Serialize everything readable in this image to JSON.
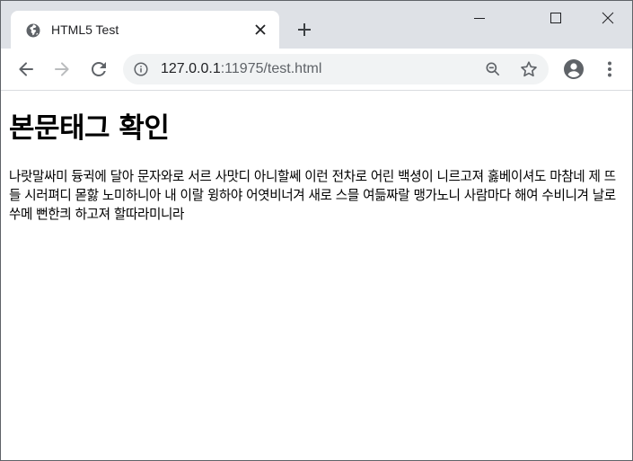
{
  "browser": {
    "tab": {
      "title": "HTML5 Test"
    },
    "address_bar": {
      "host": "127.0.0.1",
      "port_path": ":11975/test.html"
    }
  },
  "page": {
    "heading": "본문태그 확인",
    "paragraph": "나랏말싸미 듕귁에 달아 문자와로 서르 사맛디 아니할쎄 이런 전차로 어린 백셩이 니르고져 홇베이셔도 마참네 제 뜨들 시러펴디 몯핧 노미하니아 내 이랄 윙하야 어엿비너겨 새로 스믈 여듦짜랄 맹가노니 사람마다 해여 수비니겨 날로 쑤메 뻔한킈 하고져 할따라미니라"
  },
  "colors": {
    "tabstrip_bg": "#dee1e6",
    "omnibox_bg": "#f1f3f4",
    "icon": "#5f6368"
  },
  "icons": [
    "globe-icon",
    "close-icon",
    "plus-icon",
    "minimize-icon",
    "maximize-icon",
    "window-close-icon",
    "back-arrow-icon",
    "forward-arrow-icon",
    "reload-icon",
    "info-icon",
    "zoom-out-icon",
    "star-icon",
    "account-icon",
    "more-vert-icon"
  ]
}
